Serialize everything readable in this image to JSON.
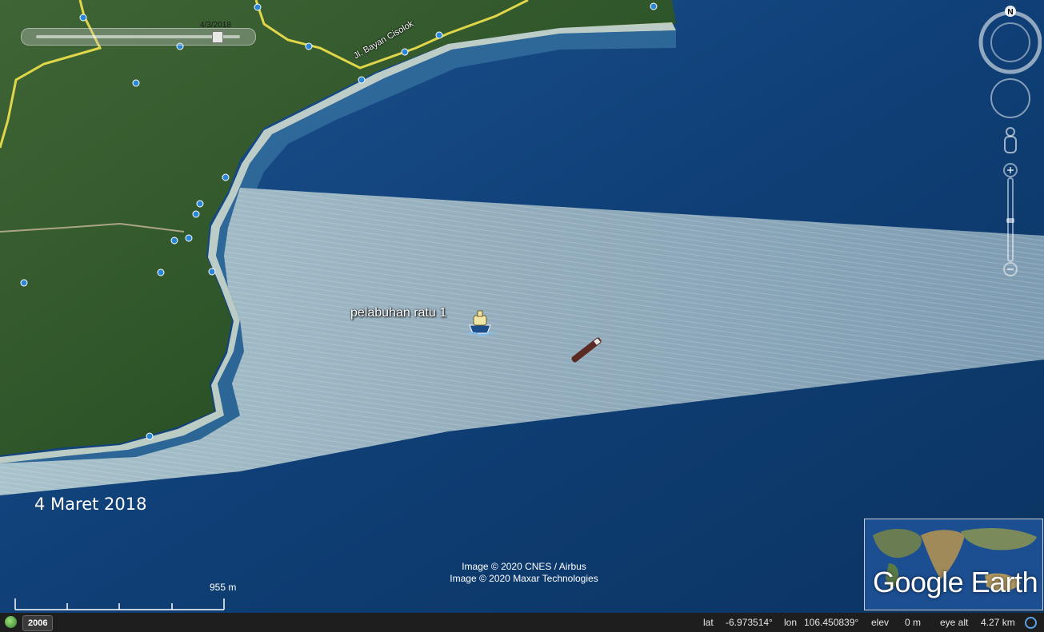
{
  "time_slider": {
    "date_label": "4/3/2018",
    "position": 0.89
  },
  "road_label": "Jl. Bayan Cisolok",
  "placemark": {
    "label": "pelabuhan ratu 1",
    "icon": "ship-icon"
  },
  "overlay_date": "4 Maret 2018",
  "attribution": [
    "Image © 2020 CNES / Airbus",
    "Image © 2020 Maxar Technologies"
  ],
  "scale_bar": {
    "label": "955 m"
  },
  "navigation": {
    "north_label": "N"
  },
  "logo": {
    "text": "Google Earth"
  },
  "status_bar": {
    "imagery_year": "2006",
    "lat_label": "lat",
    "lat_value": "-6.973514°",
    "lon_label": "lon",
    "lon_value": "106.450839°",
    "elev_label": "elev",
    "elev_value": "0 m",
    "eye_alt_label": "eye alt",
    "eye_alt_value": "4.27 km"
  },
  "colors": {
    "sea_deep": "#0c3b6e",
    "sunglint": "#9fb7c4",
    "land": "#2f5a2c",
    "road": "#e0d64a",
    "status_bar": "#1e1e1e"
  }
}
